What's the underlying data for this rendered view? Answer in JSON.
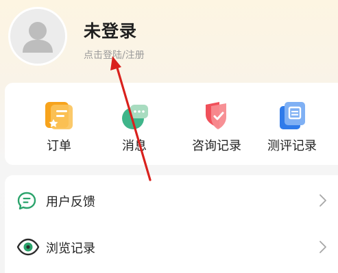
{
  "profile": {
    "avatar_icon": "default-user-avatar-icon",
    "title": "未登录",
    "subtitle": "点击登陆/注册"
  },
  "quick_actions": [
    {
      "label": "订单",
      "icon": "order-icon",
      "color": "#f7a31c"
    },
    {
      "label": "消息",
      "icon": "message-icon",
      "color": "#3fb58a"
    },
    {
      "label": "咨询记录",
      "icon": "consult-record-icon",
      "color": "#f0505a"
    },
    {
      "label": "测评记录",
      "icon": "assessment-record-icon",
      "color": "#2f7bea"
    }
  ],
  "menu": [
    {
      "label": "用户反馈",
      "icon": "feedback-icon"
    },
    {
      "label": "浏览记录",
      "icon": "eye-icon"
    }
  ],
  "colors": {
    "header_gradient_top": "#fdf5e2",
    "menu_icon_green": "#2aa36b",
    "annotation_arrow": "#d9211d"
  }
}
